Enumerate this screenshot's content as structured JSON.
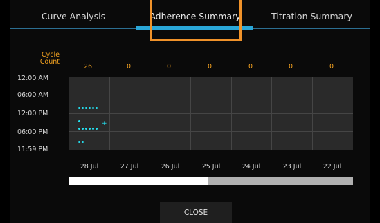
{
  "tabs": [
    {
      "label": "Curve Analysis"
    },
    {
      "label": "Adherence Summary"
    },
    {
      "label": "Titration Summary"
    }
  ],
  "active_tab": "Adherence Summary",
  "cycle_count_label": "Cycle\nCount",
  "counts": [
    "26",
    "0",
    "0",
    "0",
    "0",
    "0",
    "0"
  ],
  "time_labels": [
    "12:00 AM",
    "06:00 AM",
    "12:00 PM",
    "06:00 PM",
    "11:59 PM"
  ],
  "dates": [
    "28 Jul",
    "27 Jul",
    "26 Jul",
    "25 Jul",
    "24 Jul",
    "23 Jul",
    "22 Jul"
  ],
  "progress_fraction": 0.49,
  "close_label": "CLOSE",
  "colors": {
    "accent_orange": "#f0a020",
    "highlight_box": "#f0922a",
    "tab_active": "#2aa7d8",
    "dots": "#24e0f0",
    "grid_bg": "#2a2a2a"
  }
}
